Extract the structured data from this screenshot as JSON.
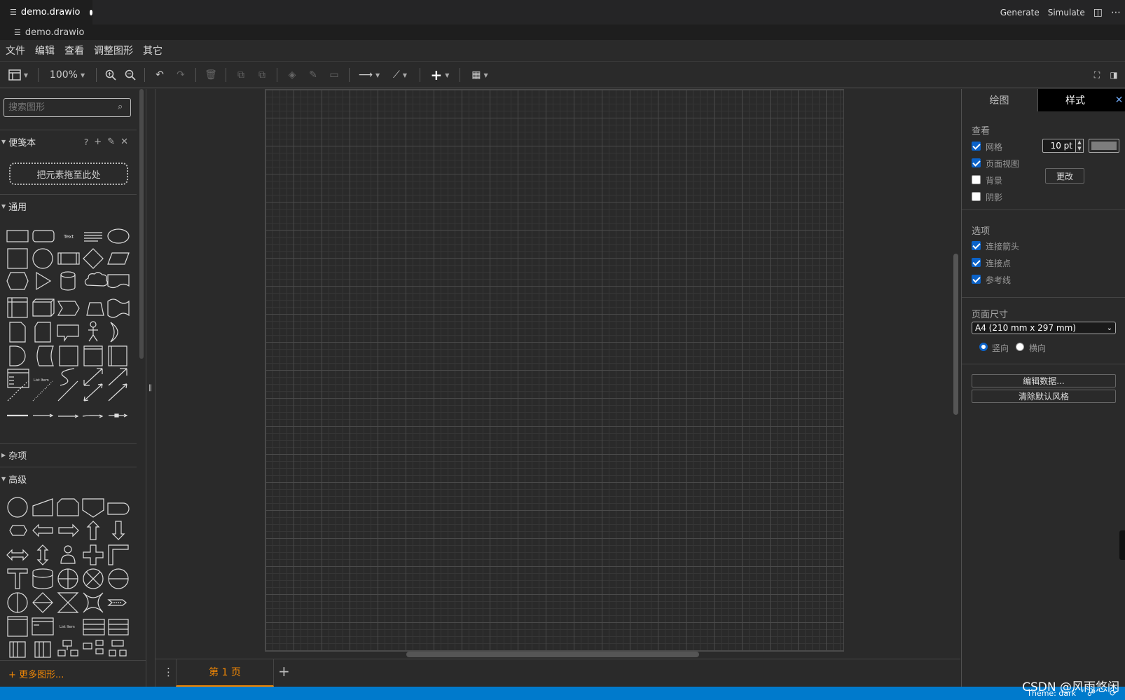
{
  "editor": {
    "tab_title": "demo.drawio",
    "breadcrumb": "demo.drawio",
    "actions": [
      "Generate",
      "Simulate"
    ]
  },
  "menu": [
    "文件",
    "编辑",
    "查看",
    "调整图形",
    "其它"
  ],
  "toolbar": {
    "zoom": "100%"
  },
  "sidebar": {
    "search_placeholder": "搜索图形",
    "scratchpad": {
      "title": "便笺本",
      "help": "?",
      "dropzone": "把元素拖至此处"
    },
    "sections": [
      "通用",
      "杂项",
      "高级"
    ],
    "more_shapes": "+ 更多图形..."
  },
  "page_tab": "第 1 页",
  "format_panel": {
    "tabs": [
      "绘图",
      "样式"
    ],
    "view_heading": "查看",
    "grid": {
      "label": "网格",
      "checked": true,
      "size": "10 pt"
    },
    "page_view": {
      "label": "页面视图",
      "checked": true
    },
    "background": {
      "label": "背景",
      "checked": false,
      "change_button": "更改"
    },
    "shadow": {
      "label": "阴影",
      "checked": false
    },
    "options_heading": "选项",
    "connection_arrows": {
      "label": "连接箭头",
      "checked": true
    },
    "connection_points": {
      "label": "连接点",
      "checked": true
    },
    "guides": {
      "label": "参考线",
      "checked": true
    },
    "page_size_heading": "页面尺寸",
    "page_size": "A4 (210 mm x 297 mm)",
    "portrait": "竖向",
    "landscape": "横向",
    "orientation": "portrait",
    "edit_data": "编辑数据...",
    "clear_style": "清除默认风格"
  },
  "status": {
    "theme": "Theme: dark"
  },
  "watermark": "CSDN @风雨悠闲",
  "colors": {
    "accent": "#f08705",
    "statusbar": "#007acc",
    "checkbox": "#0b62c8"
  }
}
